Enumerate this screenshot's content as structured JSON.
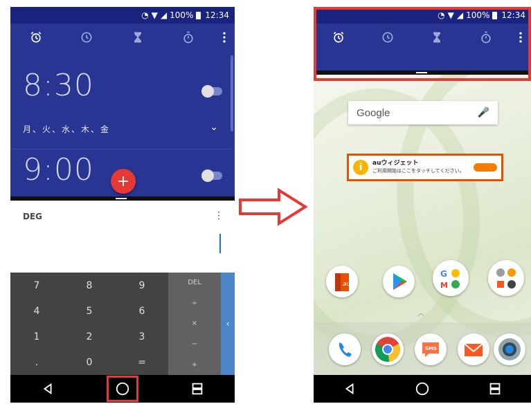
{
  "left_phone": {
    "alarms": [
      {
        "time": "8:30",
        "days": "月、火、水、木、金"
      },
      {
        "time": "9:00"
      }
    ],
    "calculator": {
      "mode": "DEG",
      "keys": [
        "7",
        "8",
        "9",
        "4",
        "5",
        "6",
        "1",
        "2",
        "3",
        ".",
        "0",
        "="
      ],
      "operators": [
        "DEL",
        "÷",
        "×",
        "−",
        "+"
      ]
    }
  },
  "right_phone": {
    "status": {
      "battery": "100%",
      "time": "12:34"
    },
    "google_search": {
      "logo": "Google"
    },
    "au_widget": {
      "title": "auウィジェット",
      "subtitle": "ご利用開始はここをタッチしてください。"
    },
    "apps": [
      "au-app",
      "play-store",
      "google-folder",
      "tools-folder",
      "phone",
      "chrome",
      "sms",
      "au-mail",
      "camera"
    ]
  },
  "status_left": {
    "battery": "100%",
    "time": "12:34"
  },
  "icons": {
    "alarm": "alarm-clock-icon",
    "clock": "clock-icon",
    "timer": "hourglass-icon",
    "stopwatch": "stopwatch-icon",
    "more": "more-vert-icon",
    "back": "back-triangle-icon",
    "home": "home-circle-icon",
    "recents": "recents-icon"
  },
  "colors": {
    "highlight": "#e53935",
    "clock_bg": "#283593",
    "fab": "#e53935"
  }
}
